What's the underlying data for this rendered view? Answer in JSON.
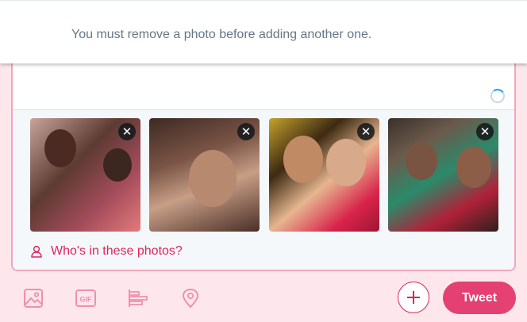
{
  "toast": {
    "message": "You must remove a photo before adding another one."
  },
  "media": {
    "remove_glyph": "✕",
    "tag_label": "Who's in these photos?"
  },
  "toolbar": {
    "icons": [
      "image-icon",
      "gif-icon",
      "poll-icon",
      "location-icon"
    ],
    "gif_text": "GIF",
    "tweet_label": "Tweet"
  },
  "colors": {
    "accent": "#e0245e",
    "background": "#fde6ec",
    "muted_text": "#657786"
  }
}
